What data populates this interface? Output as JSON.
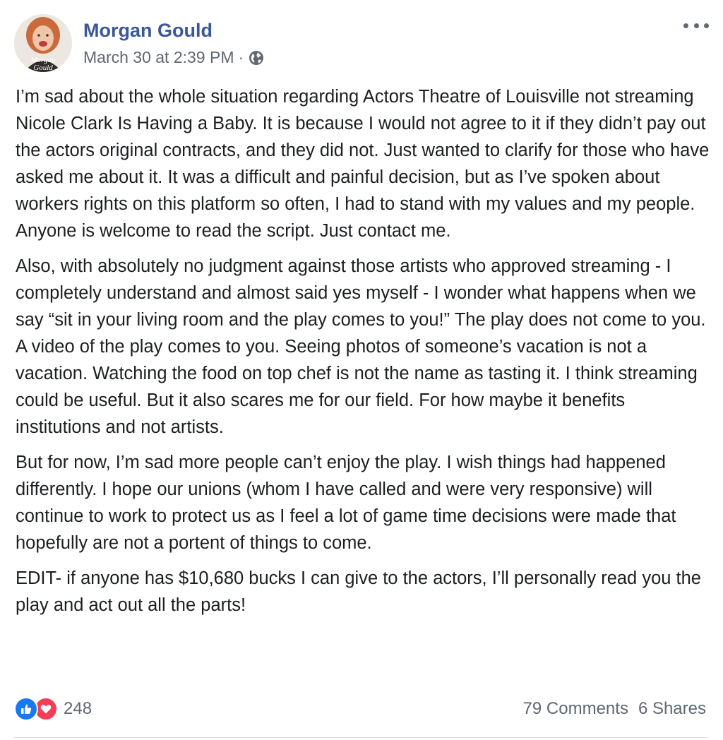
{
  "post": {
    "author": {
      "name": "Morgan Gould",
      "avatar_text": "Morgan Gould"
    },
    "timestamp": "March 30 at 2:39 PM",
    "separator": "·",
    "privacy_icon": "globe-icon",
    "more_icon": "more-options-icon",
    "paragraphs": [
      "I’m sad about the whole situation regarding Actors Theatre of Louisville not streaming Nicole Clark Is Having a Baby. It is because I would not agree to it if they didn’t pay out the actors original contracts, and they did not. Just wanted to clarify for those who have asked me about it. It was a difficult and painful decision, but as I’ve spoken about workers rights on this platform so often, I had to stand with my values and my people. Anyone is welcome to read the script. Just contact me.",
      "Also, with absolutely no judgment against those artists who approved streaming - I completely understand and almost said yes myself - I wonder what happens when we say “sit in your living room and the play comes to you!” The play does not come to you. A video of the play comes to you. Seeing photos of someone’s vacation is not a vacation. Watching the food on top chef is not the name as tasting it. I think streaming could be useful. But it also scares me for our field. For how maybe it benefits institutions and not artists.",
      "But for now, I’m sad more people can’t enjoy the play. I wish things had happened differently. I hope our unions (whom I have called and were very responsive) will continue to work to protect us as I feel a lot of game time decisions were made that hopefully are not a portent of things to come.",
      "EDIT- if anyone has $10,680 bucks I can give to the actors, I’ll personally read you the play and act out all the parts!"
    ],
    "reactions": {
      "icons": [
        "like-icon",
        "love-icon"
      ],
      "count": "248"
    },
    "stats": {
      "comments": "79 Comments",
      "shares": "6 Shares"
    },
    "colors": {
      "author_link": "#385898",
      "meta_text": "#606770",
      "like": "#1877f2",
      "love": "#f33e58"
    }
  }
}
